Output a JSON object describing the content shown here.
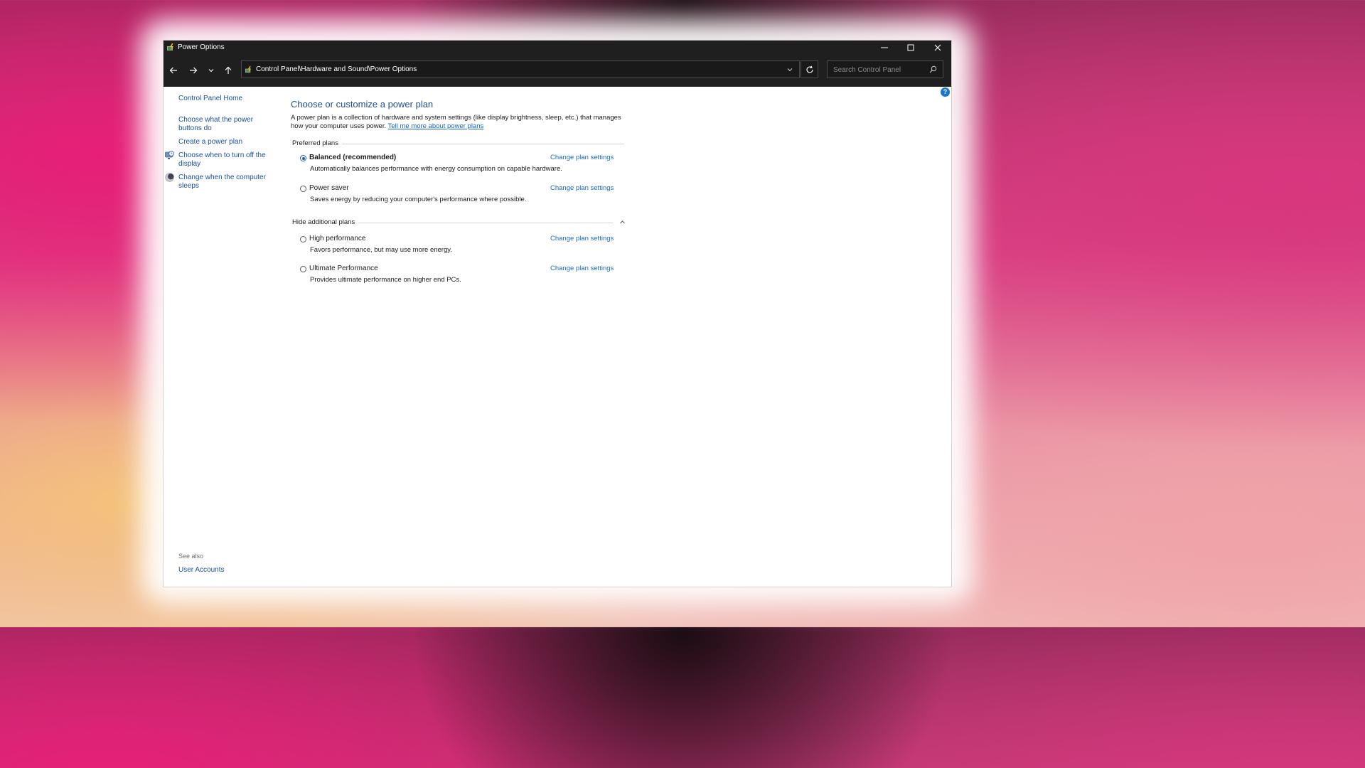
{
  "window": {
    "title": "Power Options",
    "controls": [
      "minimize",
      "maximize",
      "close"
    ]
  },
  "navigation": {
    "address_path": "Control Panel\\Hardware and Sound\\Power Options",
    "search_placeholder": "Search Control Panel"
  },
  "sidebar": {
    "home_label": "Control Panel Home",
    "links": [
      {
        "label": "Choose what the power buttons do"
      },
      {
        "label": "Create a power plan"
      },
      {
        "label": "Choose when to turn off the display",
        "icon": "display-clock-icon"
      },
      {
        "label": "Change when the computer sleeps",
        "icon": "moon-icon"
      }
    ],
    "see_also_label": "See also",
    "see_also_links": [
      {
        "label": "User Accounts"
      }
    ]
  },
  "main": {
    "heading": "Choose or customize a power plan",
    "description": "A power plan is a collection of hardware and system settings (like display brightness, sleep, etc.) that manages how your computer uses power.",
    "learn_more_link": "Tell me more about power plans",
    "preferred_label": "Preferred plans",
    "additional_label": "Hide additional plans",
    "change_label": "Change plan settings",
    "plans": [
      {
        "name": "Balanced (recommended)",
        "description": "Automatically balances performance with energy consumption on capable hardware.",
        "selected": true
      },
      {
        "name": "Power saver",
        "description": "Saves energy by reducing your computer's performance where possible.",
        "selected": false
      },
      {
        "name": "High performance",
        "description": "Favors performance, but may use more energy.",
        "selected": false
      },
      {
        "name": "Ultimate Performance",
        "description": "Provides ultimate performance on higher end PCs.",
        "selected": false
      }
    ]
  },
  "colors": {
    "link": "#1a4f9c",
    "heading": "#1e4f94",
    "titlebar": "#1f1f1f",
    "accent": "#1a5fb4"
  }
}
